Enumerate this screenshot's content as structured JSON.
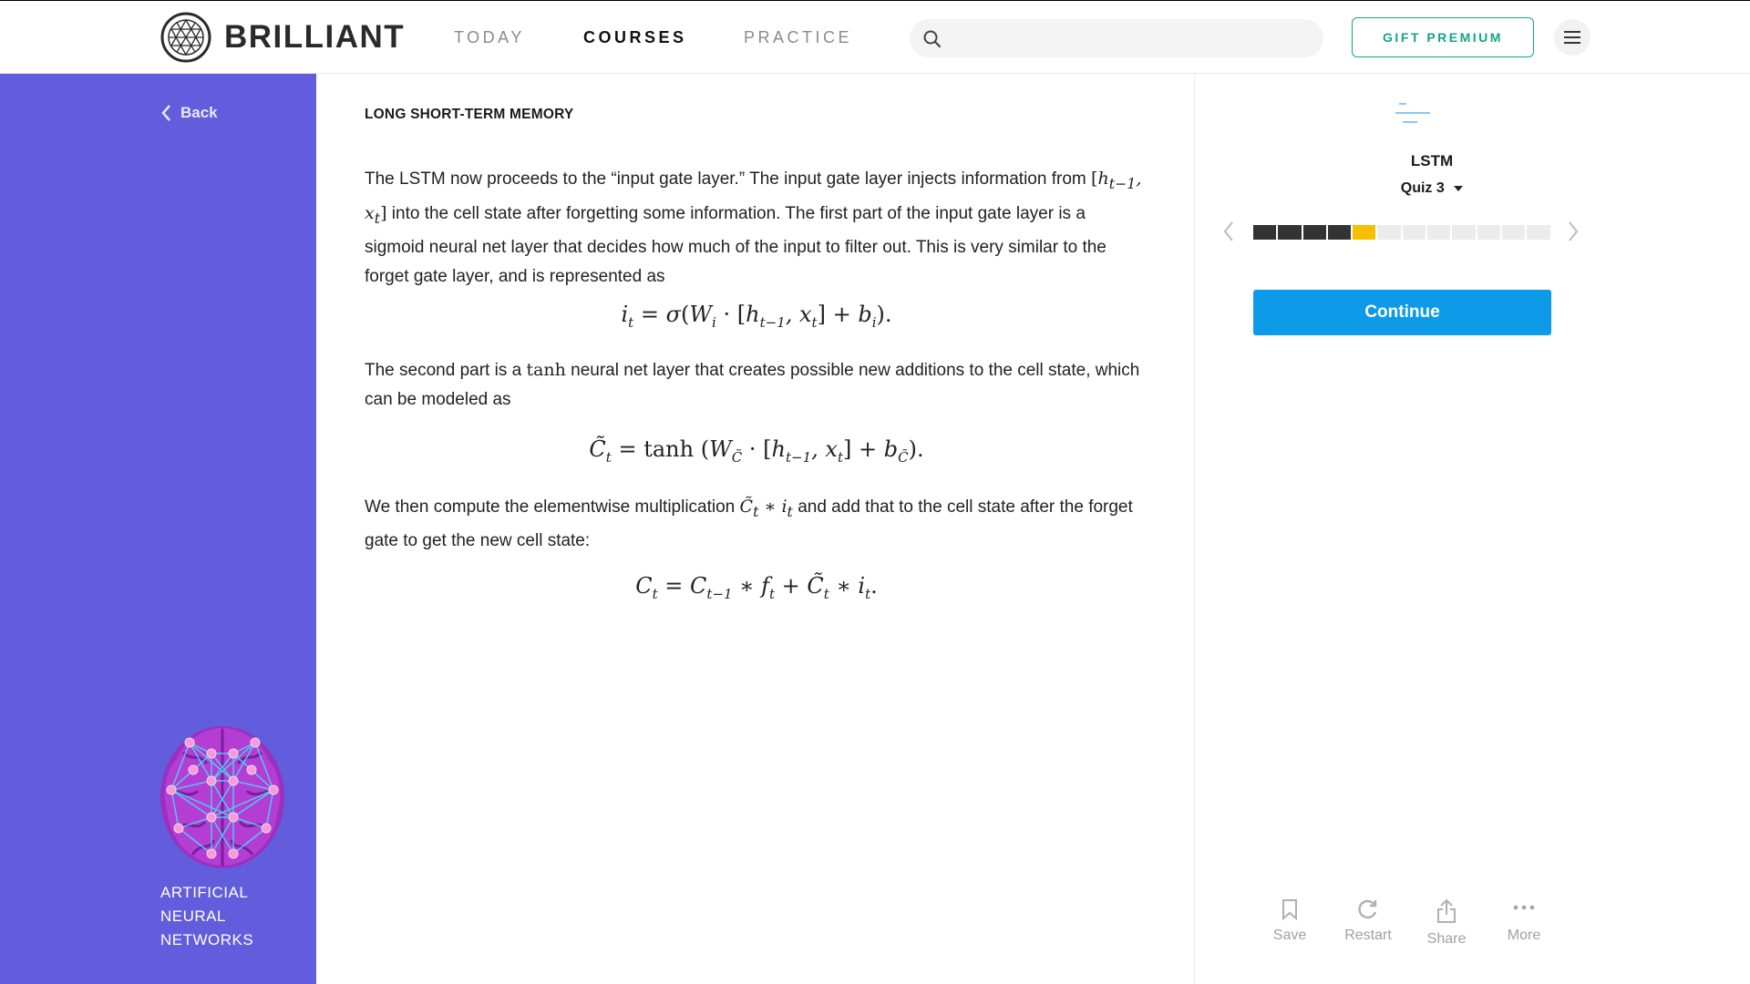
{
  "header": {
    "brand": "BRILLIANT",
    "nav": [
      {
        "label": "TODAY",
        "active": false
      },
      {
        "label": "COURSES",
        "active": true
      },
      {
        "label": "PRACTICE",
        "active": false
      }
    ],
    "search": {
      "value": "",
      "placeholder": ""
    },
    "gift_label": "GIFT PREMIUM"
  },
  "sidebar": {
    "back_label": "Back",
    "course_lines": [
      "ARTIFICIAL",
      "NEURAL",
      "NETWORKS"
    ],
    "color": "#625ddc"
  },
  "content": {
    "section_title": "LONG SHORT-TERM MEMORY",
    "p1_a": "The LSTM now proceeds to the “input gate layer.” The input gate layer injects information from",
    "p1_b": "into the cell state after forgetting some information. The first part of the input gate layer is a sigmoid neural net layer that decides how much of the input to filter out. This is very similar to the forget gate layer, and is represented as",
    "p2_a": "The second part is a",
    "p2_math": "tanh",
    "p2_b": "neural net layer that creates possible new additions to the cell state, which can be modeled as",
    "p3_a": "We then compute the elementwise multiplication",
    "p3_b": "and add that to the cell state after the forget gate to get the new cell state:"
  },
  "panel": {
    "lesson_title": "LSTM",
    "quiz_label": "Quiz 3",
    "progress": {
      "completed": 4,
      "current": 5,
      "total": 12
    },
    "continue_label": "Continue",
    "actions": [
      "Save",
      "Restart",
      "Share",
      "More"
    ],
    "accent": "#0d9ae8",
    "highlight": "#f6c000"
  }
}
